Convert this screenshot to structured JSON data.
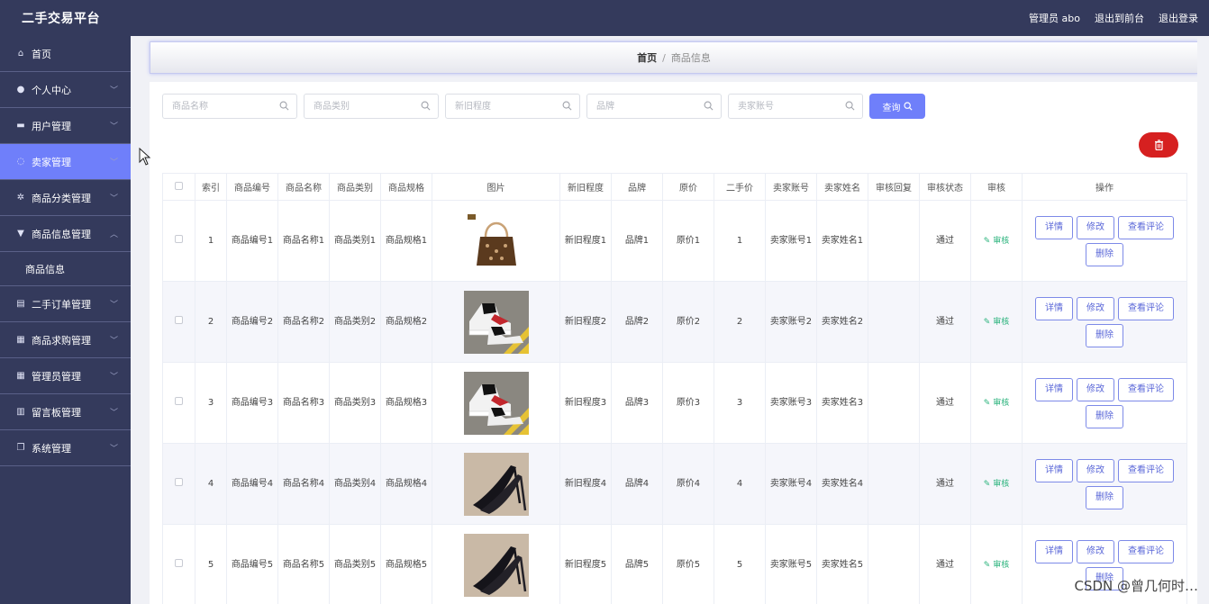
{
  "app": {
    "title": "二手交易平台",
    "admin_label": "管理员 abo",
    "to_front": "退出到前台",
    "logout": "退出登录"
  },
  "sidebar": {
    "items": [
      {
        "label": "首页",
        "icon": "home-icon",
        "glyph": "⌂",
        "chevron": false,
        "active": false
      },
      {
        "label": "个人中心",
        "icon": "user-icon",
        "glyph": "●",
        "chevron": true,
        "active": false
      },
      {
        "label": "用户管理",
        "icon": "monitor-icon",
        "glyph": "▬",
        "chevron": true,
        "active": false
      },
      {
        "label": "卖家管理",
        "icon": "cog-icon",
        "glyph": "◌",
        "chevron": true,
        "active": true
      },
      {
        "label": "商品分类管理",
        "icon": "cog-icon",
        "glyph": "✲",
        "chevron": true,
        "active": false
      },
      {
        "label": "商品信息管理",
        "icon": "pin-icon",
        "glyph": "▼",
        "chevron": true,
        "active": false,
        "expanded": true
      }
    ],
    "sub_item": "商品信息",
    "items_after": [
      {
        "label": "二手订单管理",
        "icon": "list-icon",
        "glyph": "▤"
      },
      {
        "label": "商品求购管理",
        "icon": "grid-icon",
        "glyph": "▦"
      },
      {
        "label": "管理员管理",
        "icon": "apps-icon",
        "glyph": "▦"
      },
      {
        "label": "留言板管理",
        "icon": "chart-icon",
        "glyph": "▥"
      },
      {
        "label": "系统管理",
        "icon": "copy-icon",
        "glyph": "❐"
      }
    ]
  },
  "breadcrumb": {
    "home": "首页",
    "sep": "/",
    "current": "商品信息"
  },
  "search": {
    "fields": [
      {
        "placeholder": "商品名称"
      },
      {
        "placeholder": "商品类别"
      },
      {
        "placeholder": "新旧程度"
      },
      {
        "placeholder": "品牌"
      },
      {
        "placeholder": "卖家账号"
      }
    ],
    "query_label": "查询"
  },
  "table": {
    "headers": [
      "",
      "索引",
      "商品编号",
      "商品名称",
      "商品类别",
      "商品规格",
      "图片",
      "新旧程度",
      "品牌",
      "原价",
      "二手价",
      "卖家账号",
      "卖家姓名",
      "审核回复",
      "审核状态",
      "审核",
      "操作"
    ],
    "rows": [
      {
        "index": "1",
        "code": "商品编号1",
        "name": "商品名称1",
        "cat": "商品类别1",
        "spec": "商品规格1",
        "image": "handbag",
        "cond": "新旧程度1",
        "brand": "品牌1",
        "orig": "原价1",
        "price": "1",
        "acct": "卖家账号1",
        "seller": "卖家姓名1",
        "reply": "",
        "status": "通过",
        "review": "审核"
      },
      {
        "index": "2",
        "code": "商品编号2",
        "name": "商品名称2",
        "cat": "商品类别2",
        "spec": "商品规格2",
        "image": "sneaker",
        "cond": "新旧程度2",
        "brand": "品牌2",
        "orig": "原价2",
        "price": "2",
        "acct": "卖家账号2",
        "seller": "卖家姓名2",
        "reply": "",
        "status": "通过",
        "review": "审核"
      },
      {
        "index": "3",
        "code": "商品编号3",
        "name": "商品名称3",
        "cat": "商品类别3",
        "spec": "商品规格3",
        "image": "sneaker",
        "cond": "新旧程度3",
        "brand": "品牌3",
        "orig": "原价3",
        "price": "3",
        "acct": "卖家账号3",
        "seller": "卖家姓名3",
        "reply": "",
        "status": "通过",
        "review": "审核"
      },
      {
        "index": "4",
        "code": "商品编号4",
        "name": "商品名称4",
        "cat": "商品类别4",
        "spec": "商品规格4",
        "image": "heels",
        "cond": "新旧程度4",
        "brand": "品牌4",
        "orig": "原价4",
        "price": "4",
        "acct": "卖家账号4",
        "seller": "卖家姓名4",
        "reply": "",
        "status": "通过",
        "review": "审核"
      },
      {
        "index": "5",
        "code": "商品编号5",
        "name": "商品名称5",
        "cat": "商品类别5",
        "spec": "商品规格5",
        "image": "heels",
        "cond": "新旧程度5",
        "brand": "品牌5",
        "orig": "原价5",
        "price": "5",
        "acct": "卖家账号5",
        "seller": "卖家姓名5",
        "reply": "",
        "status": "通过",
        "review": "审核"
      }
    ],
    "actions": {
      "detail": "详情",
      "edit": "修改",
      "comments": "查看评论",
      "delete": "删除"
    }
  },
  "watermark": "CSDN @曾几何时…",
  "colors": {
    "sidebar_bg": "#343a5c",
    "accent": "#6f7ffa",
    "danger": "#d62020",
    "review_green": "#2ab37c"
  }
}
